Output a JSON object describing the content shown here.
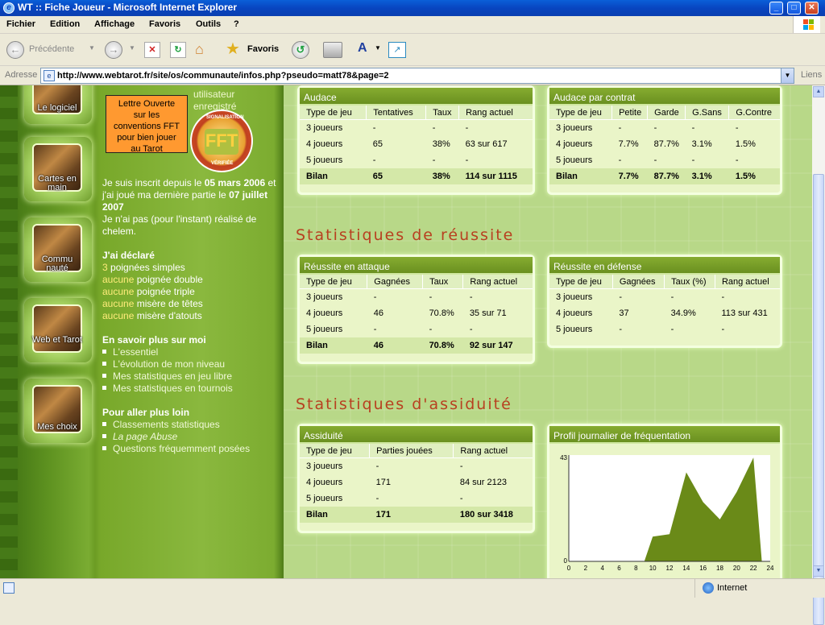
{
  "window": {
    "title": "WT :: Fiche Joueur - Microsoft Internet Explorer"
  },
  "menu": [
    "Fichier",
    "Edition",
    "Affichage",
    "Favoris",
    "Outils",
    "?"
  ],
  "toolbar": {
    "back": "Précédente",
    "favorites": "Favoris"
  },
  "address": {
    "label": "Adresse",
    "url": "http://www.webtarot.fr/site/os/communaute/infos.php?pseudo=matt78&page=2",
    "links": "Liens"
  },
  "status": {
    "zone": "Internet"
  },
  "sidebar": {
    "nav": [
      "Le logiciel",
      "Cartes en main",
      "Commu nauté",
      "Web et Tarot",
      "Mes choix"
    ],
    "lettre": [
      "Lettre Ouverte",
      "sur les",
      "conventions FFT",
      "pour bien jouer",
      "au Tarot"
    ],
    "utilisateur": [
      "utilisateur",
      "enregistré"
    ],
    "fft": {
      "text": "FFT",
      "arc_top": "SIGNALISATION",
      "arc_bottom": "VÉRIFIÉE"
    },
    "inscrit_prefix": "Je suis inscrit depuis le",
    "inscrit_date": "05 mars 2006",
    "inscrit_mid": "et j'ai joué ma dernière partie le",
    "dernier_date": "07 juillet 2007",
    "chelem": "Je n'ai pas (pour l'instant) réalisé de chelem.",
    "declare_title": "J'ai déclaré",
    "declare": [
      {
        "n": "3",
        "t": "poignées simples"
      },
      {
        "n": "aucune",
        "t": "poignée double"
      },
      {
        "n": "aucune",
        "t": "poignée triple"
      },
      {
        "n": "aucune",
        "t": "misère de têtes"
      },
      {
        "n": "aucune",
        "t": "misère d'atouts"
      }
    ],
    "savoir_title": "En savoir plus sur moi",
    "savoir": [
      "L'essentiel",
      "L'évolution de mon niveau",
      "Mes statistiques en jeu libre",
      "Mes statistiques en tournois"
    ],
    "loin_title": "Pour aller plus loin",
    "loin": [
      "Classements statistiques",
      "La page Abuse",
      "Questions fréquemment posées"
    ]
  },
  "sections": {
    "reussite": "Statistiques de réussite",
    "assiduite": "Statistiques d'assiduité"
  },
  "audace": {
    "title": "Audace",
    "headers": [
      "Type de jeu",
      "Tentatives",
      "Taux",
      "Rang actuel"
    ],
    "rows": [
      [
        "3 joueurs",
        "-",
        "-",
        "-"
      ],
      [
        "4 joueurs",
        "65",
        "38%",
        "63 sur 617"
      ],
      [
        "5 joueurs",
        "-",
        "-",
        "-"
      ],
      [
        "Bilan",
        "65",
        "38%",
        "114 sur 1115"
      ]
    ]
  },
  "audace_contrat": {
    "title": "Audace par contrat",
    "headers": [
      "Type de jeu",
      "Petite",
      "Garde",
      "G.Sans",
      "G.Contre"
    ],
    "rows": [
      [
        "3 joueurs",
        "-",
        "-",
        "-",
        "-"
      ],
      [
        "4 joueurs",
        "7.7%",
        "87.7%",
        "3.1%",
        "1.5%"
      ],
      [
        "5 joueurs",
        "-",
        "-",
        "-",
        "-"
      ],
      [
        "Bilan",
        "7.7%",
        "87.7%",
        "3.1%",
        "1.5%"
      ]
    ]
  },
  "attaque": {
    "title": "Réussite en attaque",
    "headers": [
      "Type de jeu",
      "Gagnées",
      "Taux",
      "Rang actuel"
    ],
    "rows": [
      [
        "3 joueurs",
        "-",
        "-",
        "-"
      ],
      [
        "4 joueurs",
        "46",
        "70.8%",
        "35 sur 71"
      ],
      [
        "5 joueurs",
        "-",
        "-",
        "-"
      ],
      [
        "Bilan",
        "46",
        "70.8%",
        "92 sur 147"
      ]
    ]
  },
  "defense": {
    "title": "Réussite en défense",
    "headers": [
      "Type de jeu",
      "Gagnées",
      "Taux (%)",
      "Rang actuel"
    ],
    "rows": [
      [
        "3 joueurs",
        "-",
        "-",
        "-"
      ],
      [
        "4 joueurs",
        "37",
        "34.9%",
        "113 sur 431"
      ],
      [
        "5 joueurs",
        "-",
        "-",
        "-"
      ]
    ]
  },
  "assiduite": {
    "title": "Assiduité",
    "headers": [
      "Type de jeu",
      "Parties jouées",
      "Rang actuel"
    ],
    "rows": [
      [
        "3 joueurs",
        "-",
        "-"
      ],
      [
        "4 joueurs",
        "171",
        "84 sur 2123"
      ],
      [
        "5 joueurs",
        "-",
        "-"
      ],
      [
        "Bilan",
        "171",
        "180 sur 3418"
      ]
    ]
  },
  "profil": {
    "title": "Profil journalier de fréquentation",
    "ymax_label": "43",
    "ymin_label": "0",
    "xticks": [
      "0",
      "2",
      "4",
      "6",
      "8",
      "10",
      "12",
      "14",
      "16",
      "18",
      "20",
      "22",
      "24"
    ],
    "points": [
      [
        0,
        0
      ],
      [
        9,
        0
      ],
      [
        10,
        10
      ],
      [
        12,
        11
      ],
      [
        14,
        36
      ],
      [
        16,
        24
      ],
      [
        18,
        17
      ],
      [
        20,
        28
      ],
      [
        22,
        42
      ],
      [
        23,
        0
      ]
    ],
    "ymax": 43,
    "fill": "#6a8a18"
  }
}
